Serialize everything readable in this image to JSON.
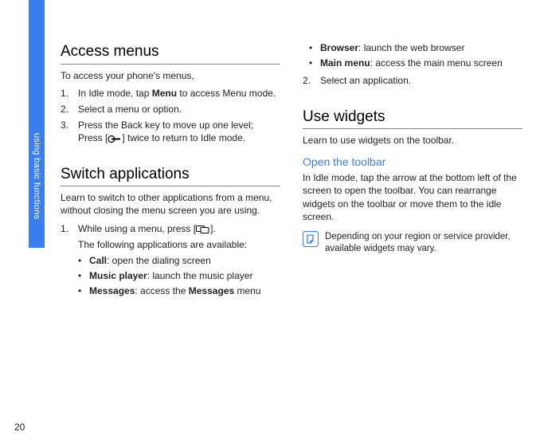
{
  "page_number": "20",
  "side_tab_label": "using basic functions",
  "left": {
    "h1_access": "Access menus",
    "access_intro": "To access your phone's menus,",
    "access_steps": [
      {
        "pre": "In Idle mode, tap ",
        "bold": "Menu",
        "post": " to access Menu mode."
      },
      {
        "pre": "Select a menu or option.",
        "bold": "",
        "post": ""
      },
      {
        "pre": "Press the Back key to move up one level; Press [",
        "bold": "",
        "post": "] twice to return to Idle mode.",
        "has_icon": true,
        "icon": "end-key-icon"
      }
    ],
    "h1_switch": "Switch applications",
    "switch_intro": "Learn to switch to other applications from a menu, without closing the menu screen you are using.",
    "switch_step1_pre": "While using a menu, press [",
    "switch_step1_post": "].",
    "switch_step1_icon": "app-switch-icon",
    "switch_sub": "The following applications are available:",
    "apps_left": [
      {
        "bold": "Call",
        "rest": ": open the dialing screen"
      },
      {
        "bold": "Music player",
        "rest": ": launch the music player"
      },
      {
        "bold": "Messages",
        "rest": ": access the ",
        "bold2": "Messages",
        "rest2": " menu"
      }
    ]
  },
  "right": {
    "apps_right": [
      {
        "bold": "Browser",
        "rest": ": launch the web browser"
      },
      {
        "bold": "Main menu",
        "rest": ": access the main menu screen"
      }
    ],
    "step2": "Select an application.",
    "h1_widgets": "Use widgets",
    "widgets_intro": "Learn to use widgets on the toolbar.",
    "h2_toolbar": "Open the toolbar",
    "toolbar_body": "In Idle mode, tap the arrow at the bottom left of the screen to open the toolbar. You can rearrange widgets on the toolbar or move them to the idle screen.",
    "note_text": "Depending on your region or service provider, available widgets may vary."
  }
}
